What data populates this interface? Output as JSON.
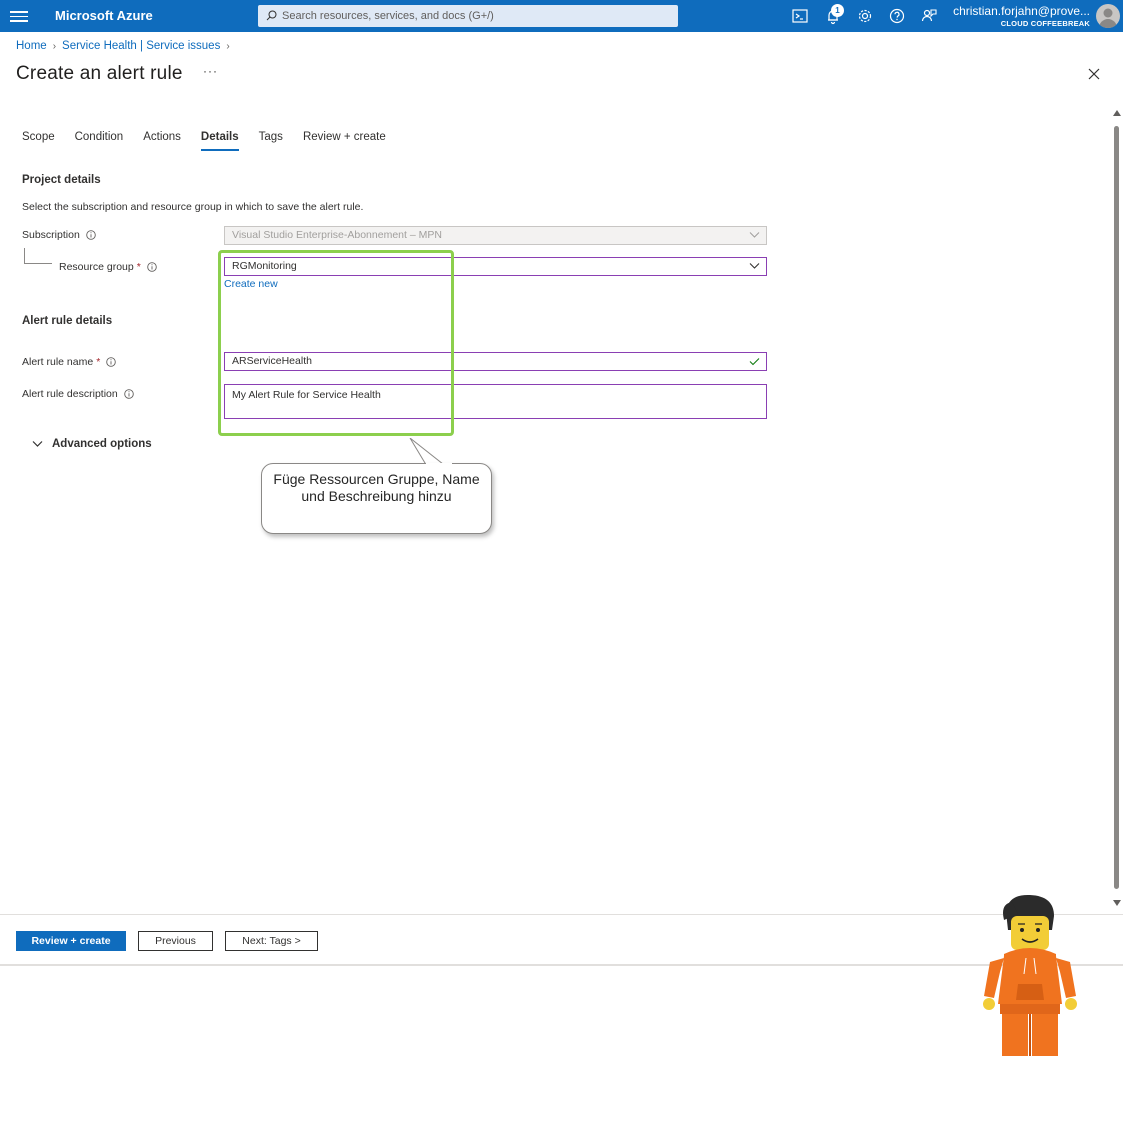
{
  "topbar": {
    "brand": "Microsoft Azure",
    "search_placeholder": "Search resources, services, and docs (G+/)",
    "notification_count": "1",
    "account_email": "christian.forjahn@prove...",
    "account_tenant": "CLOUD COFFEEBREAK",
    "icons": [
      "menu-icon",
      "search-icon",
      "cloud-shell-icon",
      "bell-icon",
      "gear-icon",
      "help-icon",
      "feedback-icon",
      "avatar"
    ]
  },
  "breadcrumb": {
    "items": [
      "Home",
      "Service Health | Service issues"
    ]
  },
  "page": {
    "title": "Create an alert rule",
    "more": "···"
  },
  "tabs": {
    "items": [
      "Scope",
      "Condition",
      "Actions",
      "Details",
      "Tags",
      "Review + create"
    ],
    "active": "Details"
  },
  "project_details": {
    "title": "Project details",
    "description": "Select the subscription and resource group in which to save the alert rule.",
    "subscription_label": "Subscription",
    "subscription_value": "Visual Studio Enterprise-Abonnement – MPN",
    "resource_group_label": "Resource group",
    "required_mark": "*",
    "resource_group_value": "RGMonitoring",
    "create_new": "Create new"
  },
  "alert_rule_details": {
    "title": "Alert rule details",
    "name_label": "Alert rule name",
    "required_mark": "*",
    "name_value": "ARServiceHealth",
    "description_label": "Alert rule description",
    "description_value": "My Alert Rule for Service Health"
  },
  "advanced_options": "Advanced options",
  "annotation": {
    "callout_text": "Füge Ressourcen Gruppe, Name und Beschreibung hinzu",
    "highlight_color": "#8ccf4d"
  },
  "footer": {
    "review_create": "Review + create",
    "previous": "Previous",
    "next": "Next: Tags >"
  },
  "colors": {
    "accent": "#0f6cbd",
    "field_border": "#8a3fb3",
    "required": "#a4262c"
  }
}
